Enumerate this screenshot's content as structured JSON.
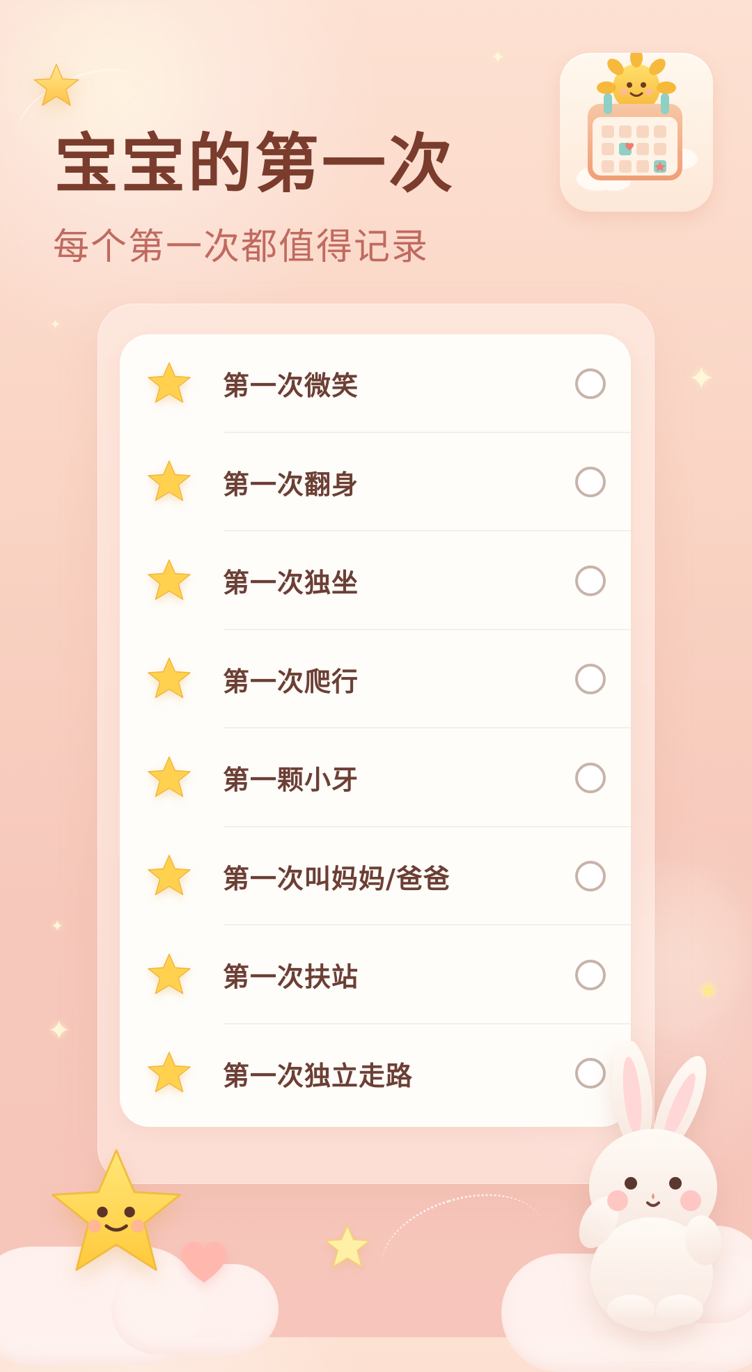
{
  "header": {
    "title": "宝宝的第一次",
    "subtitle": "每个第一次都值得记录"
  },
  "icons": {
    "app": "calendar-sun-icon",
    "row": "star-icon",
    "check": "circle-outline-icon",
    "decor_left": "smiling-star-icon",
    "decor_right": "bunny-icon",
    "heart": "heart-icon"
  },
  "milestones": {
    "items": [
      {
        "label": "第一次微笑",
        "completed": false
      },
      {
        "label": "第一次翻身",
        "completed": false
      },
      {
        "label": "第一次独坐",
        "completed": false
      },
      {
        "label": "第一次爬行",
        "completed": false
      },
      {
        "label": "第一颗小牙",
        "completed": false
      },
      {
        "label": "第一次叫妈妈/爸爸",
        "completed": false
      },
      {
        "label": "第一次扶站",
        "completed": false
      },
      {
        "label": "第一次独立走路",
        "completed": false
      }
    ]
  },
  "colors": {
    "title": "#7a3c2d",
    "subtitle": "#c06a60",
    "row_text": "#6c3f35",
    "star": "#ffd14f",
    "check_border": "#c8b3aa",
    "background_top": "#fde1d2",
    "background_bottom": "#f7c5bb"
  }
}
